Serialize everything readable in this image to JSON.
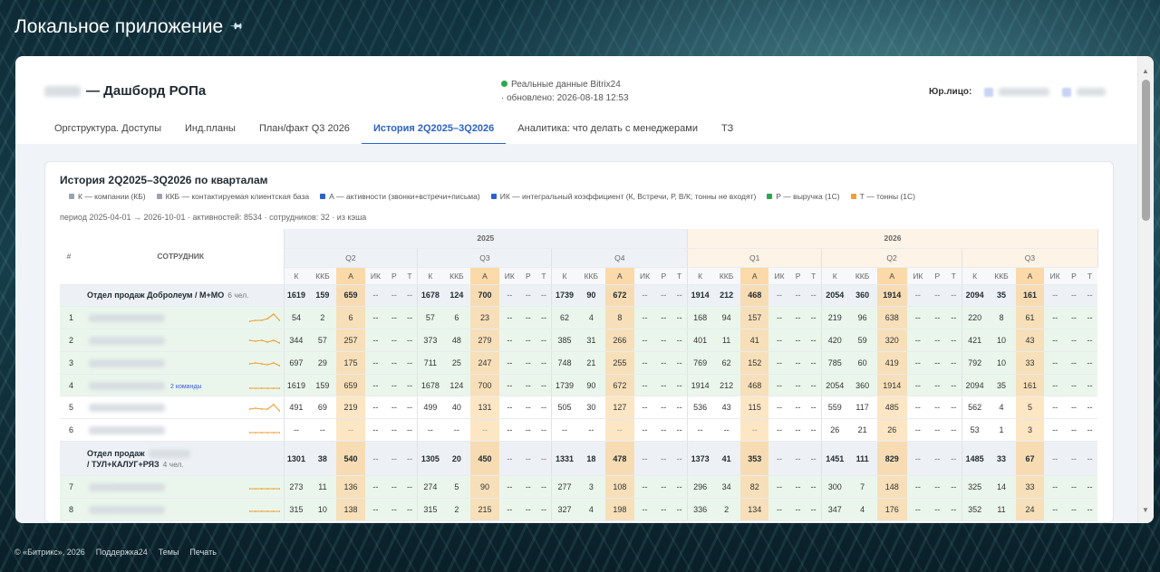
{
  "app_title": "Локальное приложение",
  "header": {
    "dash_suffix": "— Дашборд РОПа",
    "status_line1": "Реальные данные Bitrix24",
    "status_line2": "· обновлено: 2026-08-18 12:53",
    "legal_label": "Юр.лицо:"
  },
  "tabs": [
    {
      "label": "Оргструктура. Доступы"
    },
    {
      "label": "Инд.планы"
    },
    {
      "label": "План/факт Q3 2026"
    },
    {
      "label": "История 2Q2025–3Q2026",
      "active": true
    },
    {
      "label": "Аналитика: что делать с менеджерами"
    },
    {
      "label": "ТЗ"
    }
  ],
  "card": {
    "title": "История 2Q2025–3Q2026 по кварталам",
    "legend": [
      {
        "text": "К — компании (КБ)",
        "color": "#9aa3ad"
      },
      {
        "text": "ККБ — контактируемая клиентская база",
        "color": "#9aa3ad"
      },
      {
        "text": "А — активности (звонки+встречи+письма)",
        "color": "#2b62c9"
      },
      {
        "text": "ИК — интегральный коэффициент (К, Встречи, Р, В/К; тонны не входят)",
        "color": "#2b62c9"
      },
      {
        "text": "Р — выручка (1С)",
        "color": "#2aa84a"
      },
      {
        "text": "Т — тонны (1С)",
        "color": "#f0a030"
      }
    ],
    "meta": "период 2025-04-01 → 2026-10-01 · активностей: 8534 · сотрудников: 32 · из кэша"
  },
  "table": {
    "col_num": "#",
    "col_employee": "СОТРУДНИК",
    "years": [
      "2025",
      "2026"
    ],
    "quarters": [
      "Q2",
      "Q3",
      "Q4",
      "Q1",
      "Q2",
      "Q3"
    ],
    "metrics": [
      "К",
      "ККБ",
      "А",
      "ИК",
      "Р",
      "Т"
    ],
    "dash": "--",
    "rows": [
      {
        "type": "dept",
        "name": "Отдел продаж Добролеум / М+МО",
        "count": "6 чел.",
        "q": [
          [
            "1619",
            "159",
            "659"
          ],
          [
            "1678",
            "124",
            "700"
          ],
          [
            "1739",
            "90",
            "672"
          ],
          [
            "1914",
            "212",
            "468"
          ],
          [
            "2054",
            "360",
            "1914"
          ],
          [
            "2094",
            "35",
            "161"
          ]
        ]
      },
      {
        "type": "emp",
        "num": "1",
        "color": "green",
        "spark": [
          2,
          3,
          3,
          5,
          10,
          3
        ],
        "q": [
          [
            "54",
            "2",
            "6"
          ],
          [
            "57",
            "6",
            "23"
          ],
          [
            "62",
            "4",
            "8"
          ],
          [
            "168",
            "94",
            "157"
          ],
          [
            "219",
            "96",
            "638"
          ],
          [
            "220",
            "8",
            "61"
          ]
        ]
      },
      {
        "type": "emp",
        "num": "2",
        "color": "green",
        "spark": [
          6,
          5,
          6,
          4,
          6,
          3
        ],
        "q": [
          [
            "344",
            "57",
            "257"
          ],
          [
            "373",
            "48",
            "279"
          ],
          [
            "385",
            "31",
            "266"
          ],
          [
            "401",
            "11",
            "41"
          ],
          [
            "420",
            "59",
            "320"
          ],
          [
            "421",
            "10",
            "43"
          ]
        ]
      },
      {
        "type": "emp",
        "num": "3",
        "color": "green",
        "spark": [
          5,
          6,
          5,
          4,
          6,
          3
        ],
        "q": [
          [
            "697",
            "29",
            "175"
          ],
          [
            "711",
            "25",
            "247"
          ],
          [
            "748",
            "21",
            "255"
          ],
          [
            "769",
            "62",
            "152"
          ],
          [
            "785",
            "60",
            "419"
          ],
          [
            "792",
            "10",
            "33"
          ]
        ]
      },
      {
        "type": "emp",
        "num": "4",
        "color": "green",
        "badge": "2 команды",
        "spark": [
          3,
          3,
          3,
          3,
          3,
          3
        ],
        "q": [
          [
            "1619",
            "159",
            "659"
          ],
          [
            "1678",
            "124",
            "700"
          ],
          [
            "1739",
            "90",
            "672"
          ],
          [
            "1914",
            "212",
            "468"
          ],
          [
            "2054",
            "360",
            "1914"
          ],
          [
            "2094",
            "35",
            "161"
          ]
        ]
      },
      {
        "type": "emp",
        "num": "5",
        "color": "white",
        "spark": [
          4,
          5,
          4,
          4,
          9,
          2
        ],
        "q": [
          [
            "491",
            "69",
            "219"
          ],
          [
            "499",
            "40",
            "131"
          ],
          [
            "505",
            "30",
            "127"
          ],
          [
            "536",
            "43",
            "115"
          ],
          [
            "559",
            "117",
            "485"
          ],
          [
            "562",
            "4",
            "5"
          ]
        ]
      },
      {
        "type": "emp",
        "num": "6",
        "color": "white",
        "spark": [
          3,
          3,
          3,
          3,
          3,
          3
        ],
        "q": [
          [
            "--",
            "--",
            "--"
          ],
          [
            "--",
            "--",
            "--"
          ],
          [
            "--",
            "--",
            "--"
          ],
          [
            "--",
            "--",
            "--"
          ],
          [
            "26",
            "21",
            "26"
          ],
          [
            "53",
            "1",
            "3"
          ]
        ]
      },
      {
        "type": "dept",
        "name_prefix": "Отдел продаж",
        "name_suffix": "/ ТУЛ+КАЛУГ+РЯЗ",
        "count": "4 чел.",
        "q": [
          [
            "1301",
            "38",
            "540"
          ],
          [
            "1305",
            "20",
            "450"
          ],
          [
            "1331",
            "18",
            "478"
          ],
          [
            "1373",
            "41",
            "353"
          ],
          [
            "1451",
            "111",
            "829"
          ],
          [
            "1485",
            "33",
            "67"
          ]
        ]
      },
      {
        "type": "emp",
        "num": "7",
        "color": "green",
        "spark": [
          4,
          4,
          4,
          4,
          4,
          4
        ],
        "q": [
          [
            "273",
            "11",
            "136"
          ],
          [
            "274",
            "5",
            "90"
          ],
          [
            "277",
            "3",
            "108"
          ],
          [
            "296",
            "34",
            "82"
          ],
          [
            "300",
            "7",
            "148"
          ],
          [
            "325",
            "14",
            "33"
          ]
        ]
      },
      {
        "type": "emp",
        "num": "8",
        "color": "green",
        "spark": [
          4,
          4,
          4,
          4,
          4,
          4
        ],
        "q": [
          [
            "315",
            "10",
            "138"
          ],
          [
            "315",
            "2",
            "215"
          ],
          [
            "327",
            "4",
            "198"
          ],
          [
            "336",
            "2",
            "134"
          ],
          [
            "347",
            "4",
            "176"
          ],
          [
            "352",
            "11",
            "24"
          ]
        ]
      }
    ]
  },
  "footer": {
    "copyright": "© «Битрикс», 2026",
    "support": "Поддержка24",
    "themes": "Темы",
    "print": "Печать"
  },
  "colors": {
    "accent": "#2b62c9",
    "activity_col": "#fde6c4",
    "row_green": "#eaf6ec",
    "sparkline": "#f0a030"
  }
}
